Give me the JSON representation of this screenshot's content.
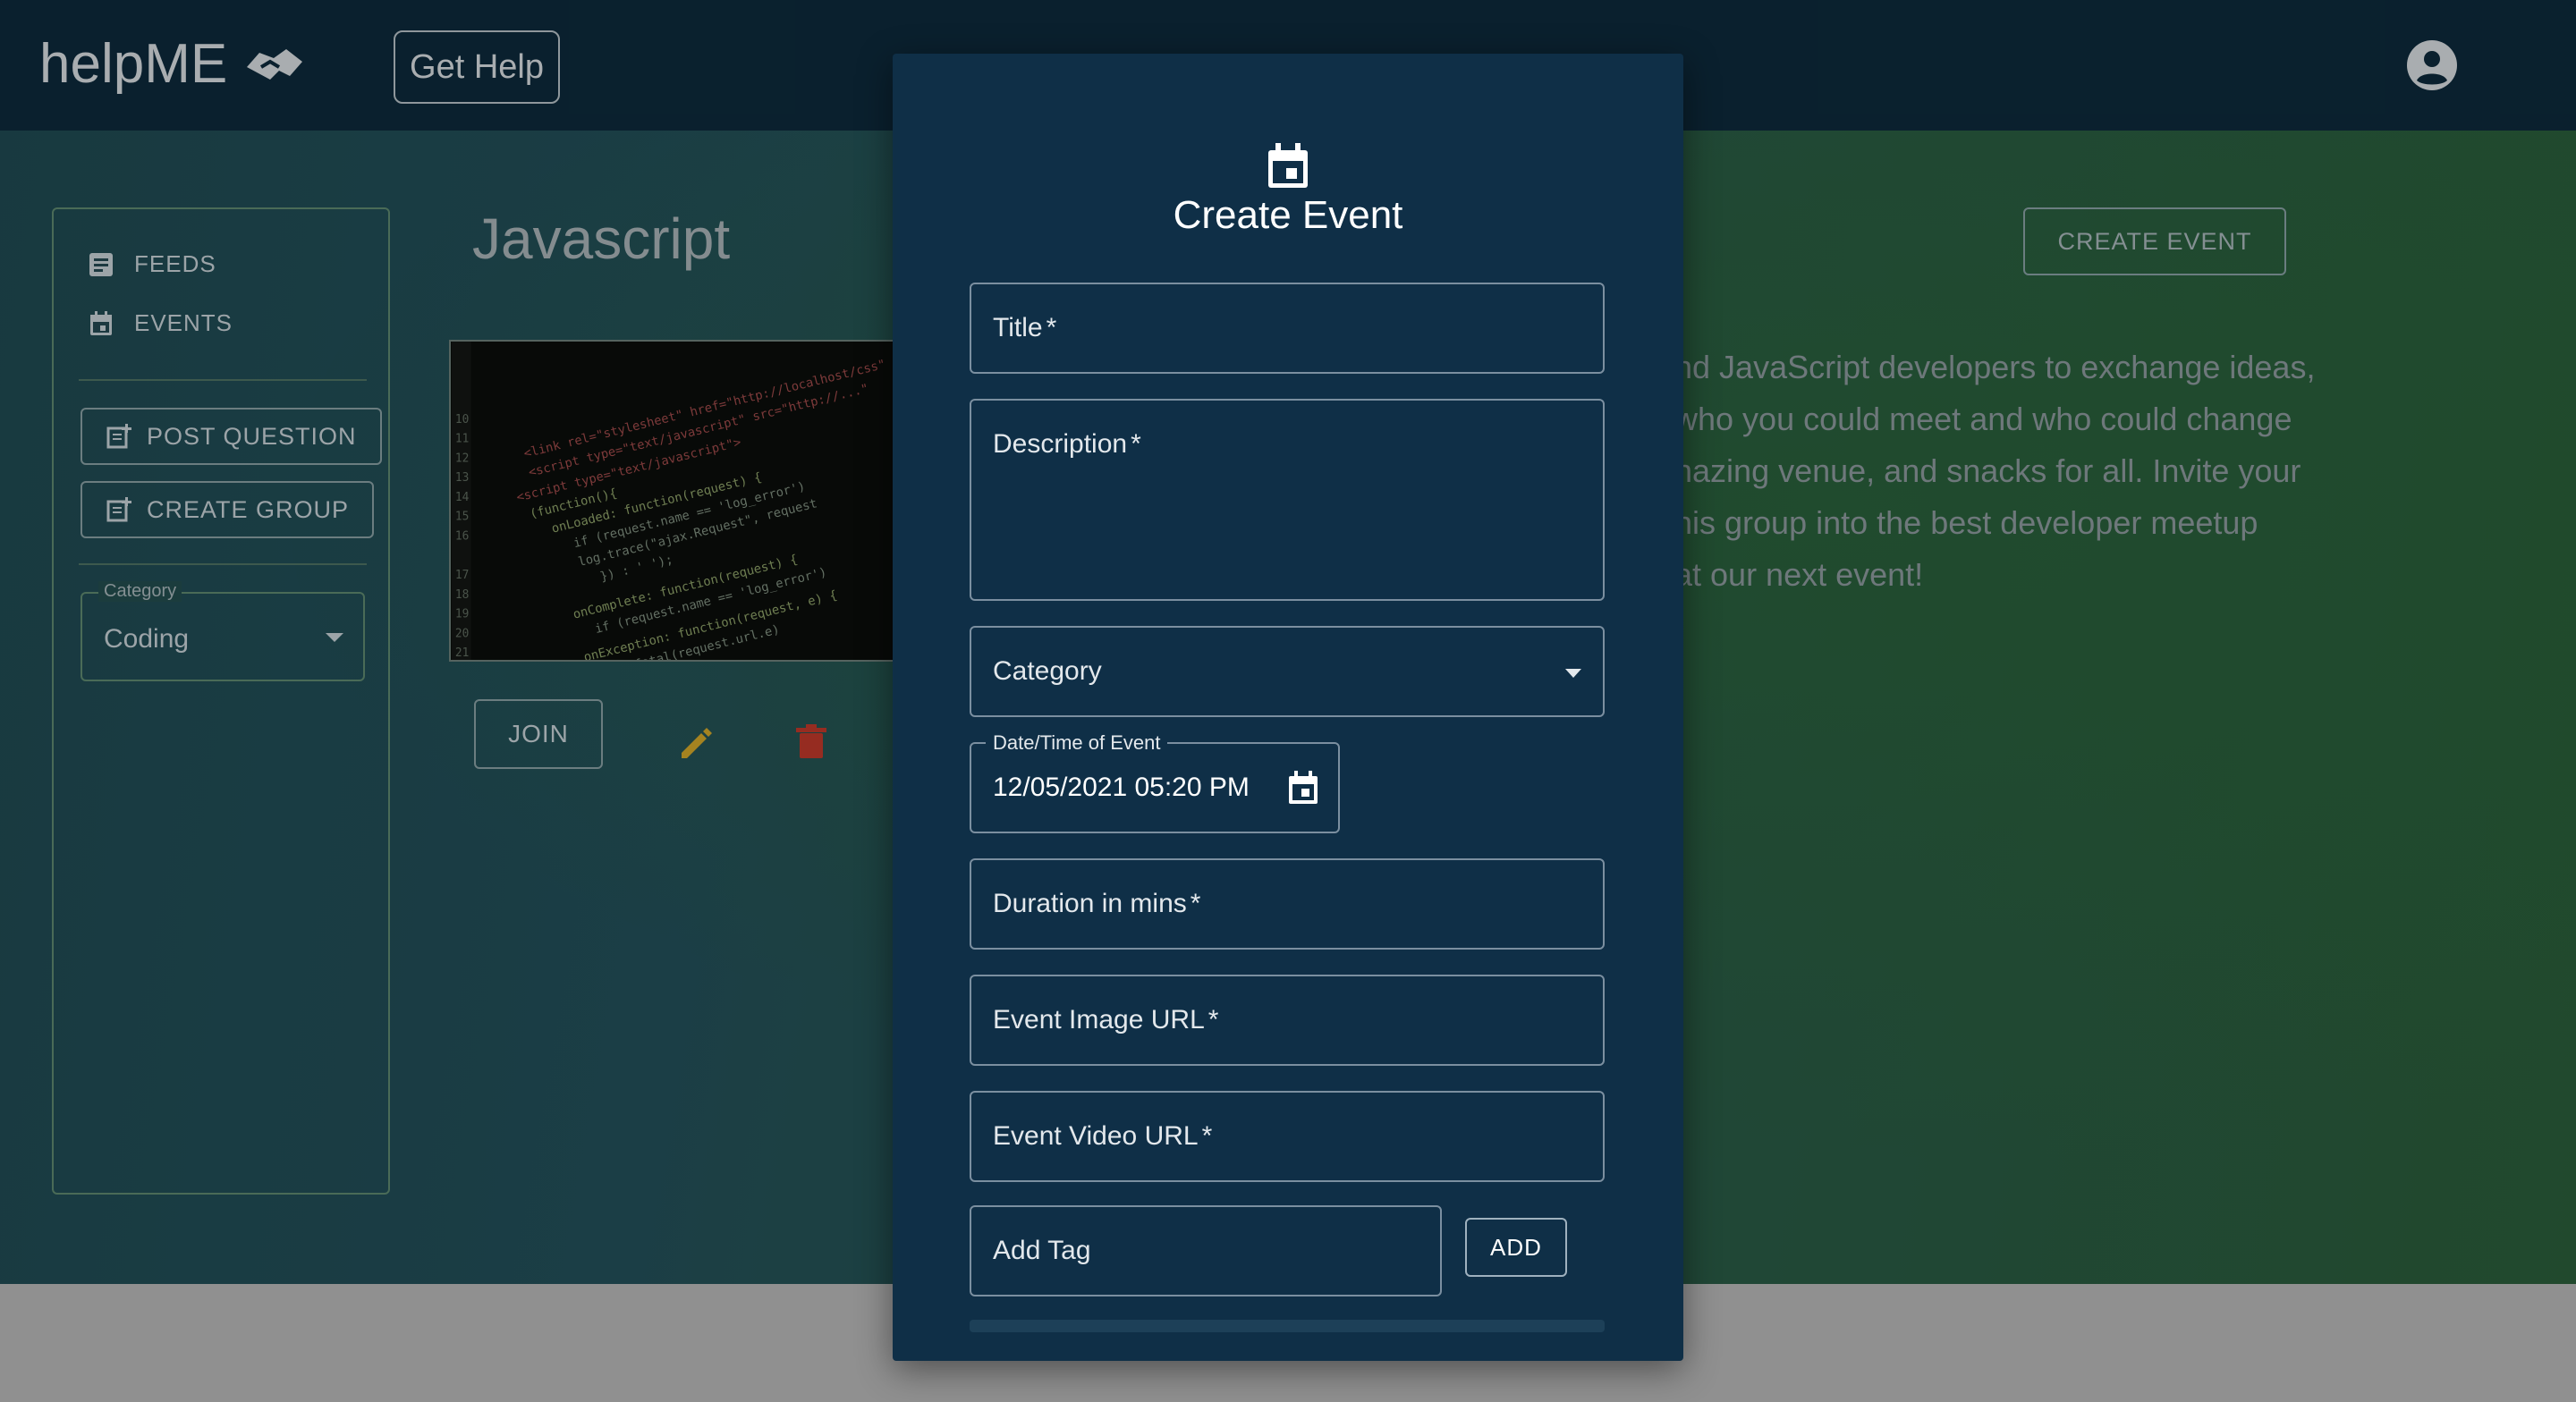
{
  "header": {
    "brand": "helpME",
    "get_help_label": "Get Help"
  },
  "sidebar": {
    "nav": [
      {
        "label": "FEEDS",
        "icon": "article-icon"
      },
      {
        "label": "EVENTS",
        "icon": "calendar-icon"
      }
    ],
    "buttons": [
      {
        "label": "POST QUESTION",
        "icon": "post-add-icon"
      },
      {
        "label": "CREATE GROUP",
        "icon": "post-add-icon"
      }
    ],
    "category_select": {
      "label": "Category",
      "value": "Coding"
    }
  },
  "main": {
    "group_title": "Javascript",
    "join_label": "JOIN",
    "create_event_label": "CREATE EVENT",
    "description_lines": [
      "nd JavaScript developers to exchange ideas,",
      "who you could meet and who could change",
      "nazing venue, and snacks for all. Invite your",
      "his group into the best developer meetup",
      "at our next event!"
    ]
  },
  "modal": {
    "title": "Create Event",
    "fields": {
      "title": {
        "label": "Title",
        "required": "*"
      },
      "description": {
        "label": "Description",
        "required": "*"
      },
      "category": {
        "label": "Category"
      },
      "datetime": {
        "label": "Date/Time of Event",
        "value": "12/05/2021 05:20 PM"
      },
      "duration": {
        "label": "Duration in mins",
        "required": "*"
      },
      "image_url": {
        "label": "Event Image URL",
        "required": "*"
      },
      "video_url": {
        "label": "Event Video URL",
        "required": "*"
      },
      "tag": {
        "label": "Add Tag"
      }
    },
    "add_label": "ADD"
  },
  "colors": {
    "appbar": "#0d2a3b",
    "modal": "#0f2f47",
    "delete_red": "#c0392b",
    "edit_yellow": "#d4a82a"
  }
}
